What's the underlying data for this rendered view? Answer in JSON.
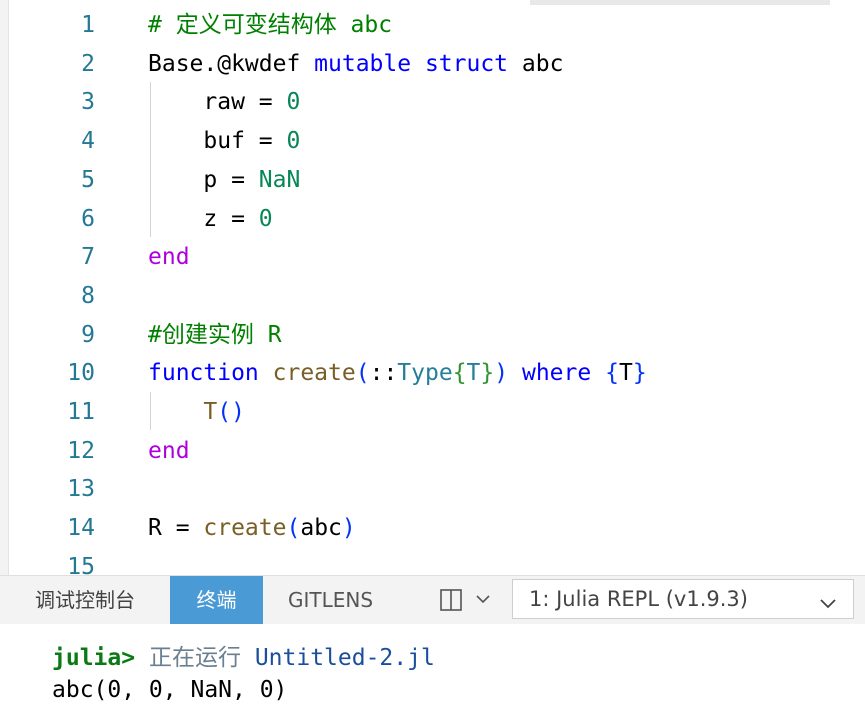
{
  "editor": {
    "lines": [
      {
        "num": "1",
        "tokens": [
          {
            "t": "# 定义可变结构体 abc",
            "c": "com"
          }
        ]
      },
      {
        "num": "2",
        "tokens": [
          {
            "t": "Base.@kwdef ",
            "c": ""
          },
          {
            "t": "mutable struct",
            "c": "kw"
          },
          {
            "t": " abc",
            "c": ""
          }
        ]
      },
      {
        "num": "3",
        "tokens": [
          {
            "t": "    raw = ",
            "c": ""
          },
          {
            "t": "0",
            "c": "num"
          }
        ]
      },
      {
        "num": "4",
        "tokens": [
          {
            "t": "    buf = ",
            "c": ""
          },
          {
            "t": "0",
            "c": "num"
          }
        ]
      },
      {
        "num": "5",
        "tokens": [
          {
            "t": "    p = ",
            "c": ""
          },
          {
            "t": "NaN",
            "c": "num"
          }
        ]
      },
      {
        "num": "6",
        "tokens": [
          {
            "t": "    z = ",
            "c": ""
          },
          {
            "t": "0",
            "c": "num"
          }
        ]
      },
      {
        "num": "7",
        "tokens": [
          {
            "t": "end",
            "c": "kw2"
          }
        ]
      },
      {
        "num": "8",
        "tokens": []
      },
      {
        "num": "9",
        "tokens": [
          {
            "t": "#创建实例 R",
            "c": "com"
          }
        ]
      },
      {
        "num": "10",
        "tokens": [
          {
            "t": "function",
            "c": "kw"
          },
          {
            "t": " ",
            "c": ""
          },
          {
            "t": "create",
            "c": "fn"
          },
          {
            "t": "(",
            "c": "br1"
          },
          {
            "t": "::",
            "c": ""
          },
          {
            "t": "Type",
            "c": "ty"
          },
          {
            "t": "{",
            "c": "br2"
          },
          {
            "t": "T",
            "c": "ty"
          },
          {
            "t": "}",
            "c": "br2"
          },
          {
            "t": ")",
            "c": "br1"
          },
          {
            "t": " ",
            "c": ""
          },
          {
            "t": "where",
            "c": "kw"
          },
          {
            "t": " ",
            "c": ""
          },
          {
            "t": "{",
            "c": "br1"
          },
          {
            "t": "T",
            "c": ""
          },
          {
            "t": "}",
            "c": "br1"
          }
        ]
      },
      {
        "num": "11",
        "tokens": [
          {
            "t": "    ",
            "c": ""
          },
          {
            "t": "T",
            "c": "fn"
          },
          {
            "t": "()",
            "c": "br1"
          }
        ]
      },
      {
        "num": "12",
        "tokens": [
          {
            "t": "end",
            "c": "kw2"
          }
        ]
      },
      {
        "num": "13",
        "tokens": []
      },
      {
        "num": "14",
        "tokens": [
          {
            "t": "R = ",
            "c": ""
          },
          {
            "t": "create",
            "c": "fn"
          },
          {
            "t": "(",
            "c": "br1"
          },
          {
            "t": "abc",
            "c": ""
          },
          {
            "t": ")",
            "c": "br1"
          }
        ]
      },
      {
        "num": "15",
        "tokens": []
      }
    ]
  },
  "panel": {
    "tabs": {
      "debug": "调试控制台",
      "terminal": "终端",
      "gitlens": "GITLENS"
    },
    "terminal_select": "1: Julia REPL (v1.9.3)"
  },
  "terminal": {
    "prompt": "julia>",
    "running": "正在运行",
    "file": "Untitled-2.jl",
    "output": "abc(0, 0, NaN, 0)"
  },
  "colors": {
    "active_tab": "#4a9ad6",
    "line_numbers": "#237893",
    "keyword": "#0000ff",
    "control": "#af00db",
    "number": "#098658",
    "comment": "#008000"
  },
  "icons": {
    "split": "split-terminal-icon",
    "chevron": "chevron-down-icon"
  }
}
